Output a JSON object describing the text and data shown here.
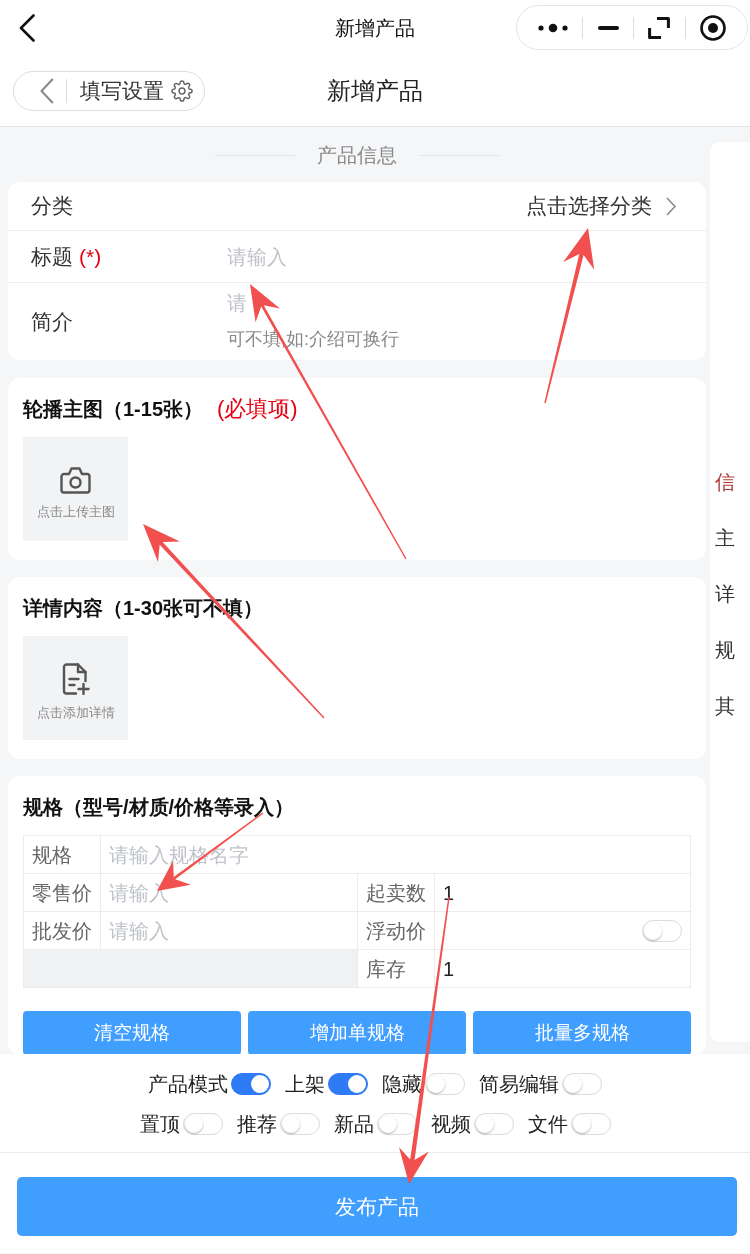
{
  "top_bar": {
    "title": "新增产品"
  },
  "nav_bar": {
    "settings_label": "填写设置",
    "title": "新增产品"
  },
  "section_title": "产品信息",
  "basic_fields": [
    {
      "kind": "select",
      "label": "分类",
      "value": "点击选择分类"
    },
    {
      "kind": "input",
      "label": "标题",
      "required_mark": "(*)",
      "placeholder": "请输入"
    },
    {
      "kind": "textarea",
      "label": "简介",
      "placeholder": "请",
      "hint": "可不填,如:介绍可换行"
    }
  ],
  "media_sections": [
    {
      "title": "轮播主图（1-15张）",
      "required_note": "(必填项)",
      "upload": {
        "kind": "camera",
        "label": "点击上传主图"
      }
    },
    {
      "title": "详情内容（1-30张可不填）",
      "upload": {
        "kind": "document",
        "label": "点击添加详情"
      }
    }
  ],
  "spec": {
    "title": "规格（型号/材质/价格等录入）",
    "name_field": {
      "label": "规格",
      "placeholder": "请输入规格名字"
    },
    "left_fields": [
      {
        "label": "零售价",
        "placeholder": "请输入"
      },
      {
        "label": "批发价",
        "placeholder": "请输入"
      }
    ],
    "right_fields": [
      {
        "kind": "input",
        "label": "起卖数",
        "value": "1"
      },
      {
        "kind": "toggle",
        "label": "浮动价",
        "on": false
      },
      {
        "kind": "input",
        "label": "库存",
        "value": "1"
      }
    ],
    "buttons": [
      "清空规格",
      "增加单规格",
      "批量多规格"
    ]
  },
  "toggle_rows": [
    [
      {
        "label": "产品模式",
        "on": true
      },
      {
        "label": "上架",
        "on": true
      },
      {
        "label": "隐藏",
        "on": false
      },
      {
        "label": "简易编辑",
        "on": false
      }
    ],
    [
      {
        "label": "置顶",
        "on": false
      },
      {
        "label": "推荐",
        "on": false
      },
      {
        "label": "新品",
        "on": false
      },
      {
        "label": "视频",
        "on": false
      },
      {
        "label": "文件",
        "on": false
      }
    ]
  ],
  "publish_button": "发布产品",
  "side_nav": [
    {
      "label": "信",
      "selected": true
    },
    {
      "label": "主",
      "selected": false
    },
    {
      "label": "详",
      "selected": false
    },
    {
      "label": "规",
      "selected": false
    },
    {
      "label": "其",
      "selected": false
    }
  ]
}
